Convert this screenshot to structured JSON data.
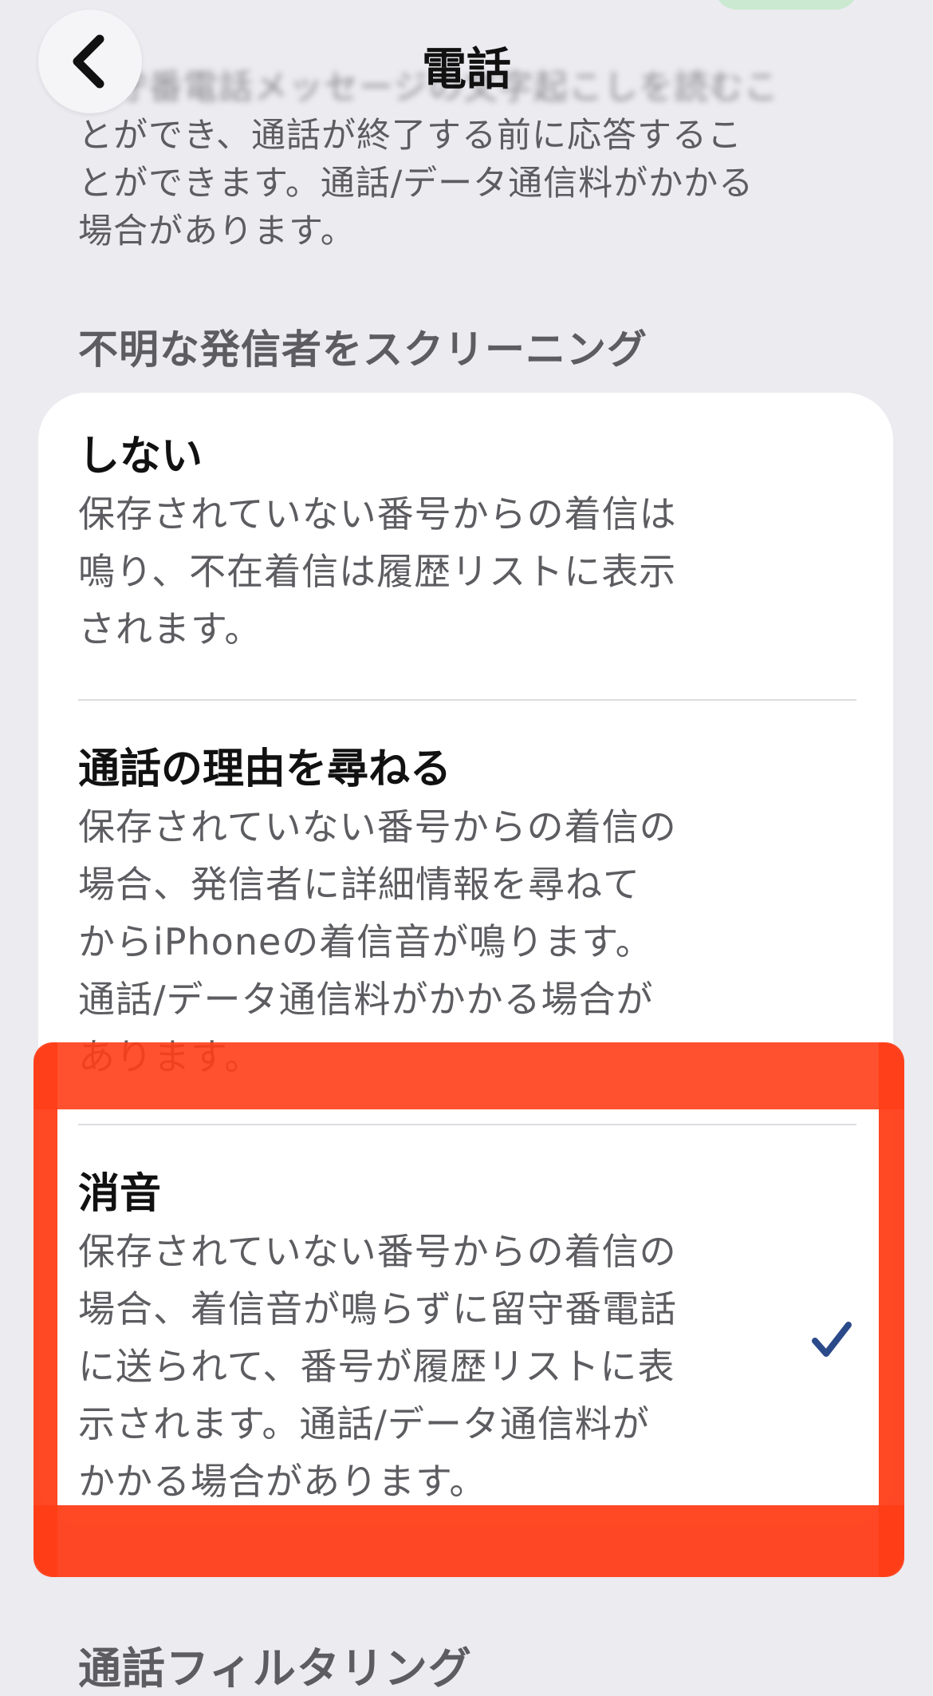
{
  "nav": {
    "title": "電話",
    "back_icon": "chevron-left-icon"
  },
  "previous_text": {
    "line1": "留守番電話メッセージの文字起こしを読むこ",
    "line2": "とができ、通話が終了する前に応答するこ",
    "line3": "とができます。通話/データ通信料がかかる",
    "line4": "場合があります。"
  },
  "section": {
    "header": "不明な発信者をスクリーニング"
  },
  "options": [
    {
      "title": "しない",
      "desc_lines": [
        "保存されていない番号からの着信は",
        "鳴り、不在着信は履歴リストに表示",
        "されます。"
      ],
      "selected": false
    },
    {
      "title": "通話の理由を尋ねる",
      "desc_lines": [
        "保存されていない番号からの着信の",
        "場合、発信者に詳細情報を尋ねて",
        "からiPhoneの着信音が鳴ります。",
        "通話/データ通信料がかかる場合が",
        "あります。"
      ],
      "selected": false
    },
    {
      "title": "消音",
      "desc_lines": [
        "保存されていない番号からの着信の",
        "場合、着信音が鳴らずに留守番電話",
        "に送られて、番号が履歴リストに表",
        "示されます。通話/データ通信料が",
        "かかる場合があります。"
      ],
      "selected": true,
      "check_icon": "checkmark-icon"
    }
  ],
  "next_section": {
    "header": "通話フィルタリング"
  },
  "colors": {
    "background": "#ebebf0",
    "card": "#ffffff",
    "highlight": "#ff3e18",
    "check": "#2b4a8a",
    "secondary_text": "#5c5c61"
  }
}
